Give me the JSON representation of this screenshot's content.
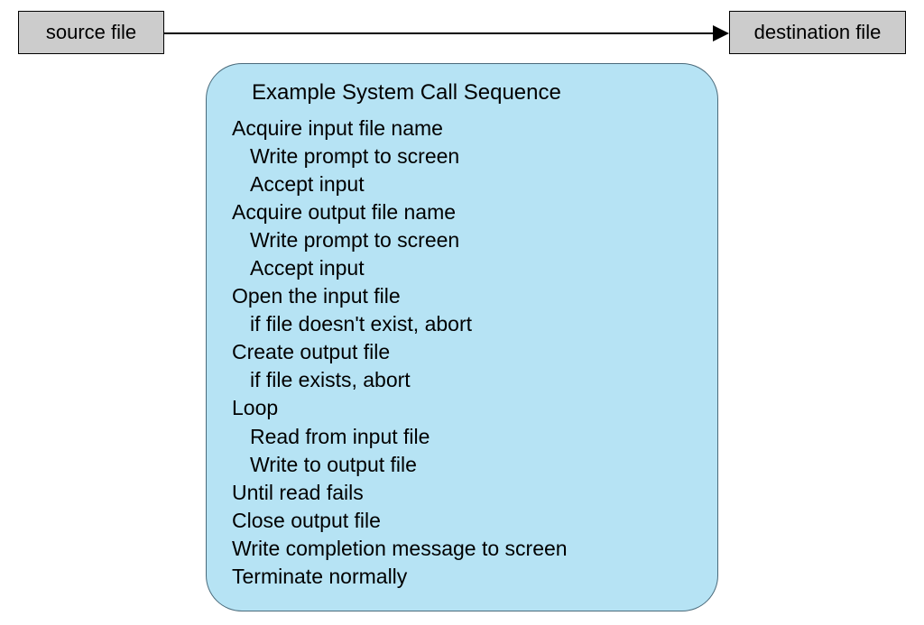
{
  "source_label": "source file",
  "destination_label": "destination  file",
  "sequence": {
    "title": "Example System Call Sequence",
    "steps": {
      "s1": "Acquire input file name",
      "s1a": "Write prompt to screen",
      "s1b": "Accept input",
      "s2": "Acquire output file name",
      "s2a": "Write prompt to screen",
      "s2b": "Accept input",
      "s3": "Open the input file",
      "s3a": "if file doesn't exist, abort",
      "s4": "Create output file",
      "s4a": "if file exists, abort",
      "s5": "Loop",
      "s5a": "Read from input file",
      "s5b": "Write to output file",
      "s6": "Until read fails",
      "s7": "Close output file",
      "s8": "Write completion message to screen",
      "s9": "Terminate normally"
    }
  }
}
